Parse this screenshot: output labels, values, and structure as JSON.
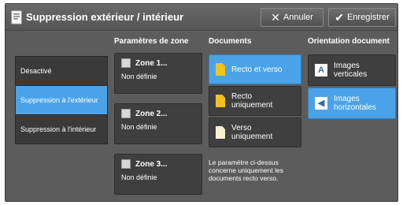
{
  "header": {
    "title": "Suppression extérieur / intérieur",
    "cancel_label": "Annuler",
    "save_label": "Enregistrer"
  },
  "mode_list": {
    "items": [
      {
        "label": "Désactivé",
        "selected": false
      },
      {
        "label": "Suppression à l'extérieur",
        "selected": true
      },
      {
        "label": "Suppression à l'intérieur",
        "selected": false
      }
    ]
  },
  "zones": {
    "heading": "Paramètres de zone",
    "items": [
      {
        "title": "Zone 1...",
        "status": "Non définie"
      },
      {
        "title": "Zone 2...",
        "status": "Non définie"
      },
      {
        "title": "Zone 3...",
        "status": "Non définie"
      }
    ]
  },
  "documents": {
    "heading": "Documents",
    "items": [
      {
        "label": "Recto et verso",
        "selected": true,
        "icon": "duplex-doc-icon"
      },
      {
        "label": "Recto uniquement",
        "selected": false,
        "icon": "front-doc-icon"
      },
      {
        "label": "Verso uniquement",
        "selected": false,
        "icon": "back-doc-icon"
      }
    ],
    "note": "Le paramètre ci-dessus concerne uniquement les documents recto verso."
  },
  "orientation": {
    "heading": "Orientation document",
    "items": [
      {
        "label": "Images verticales",
        "selected": false,
        "glyph": "A"
      },
      {
        "label": "Images horizontales",
        "selected": true,
        "glyph": "◀"
      }
    ]
  },
  "colors": {
    "selected": "#4aa3e8",
    "tile": "#3f3f3f",
    "panel": "#5c5c5c",
    "doc_icon": "#f0c419"
  }
}
